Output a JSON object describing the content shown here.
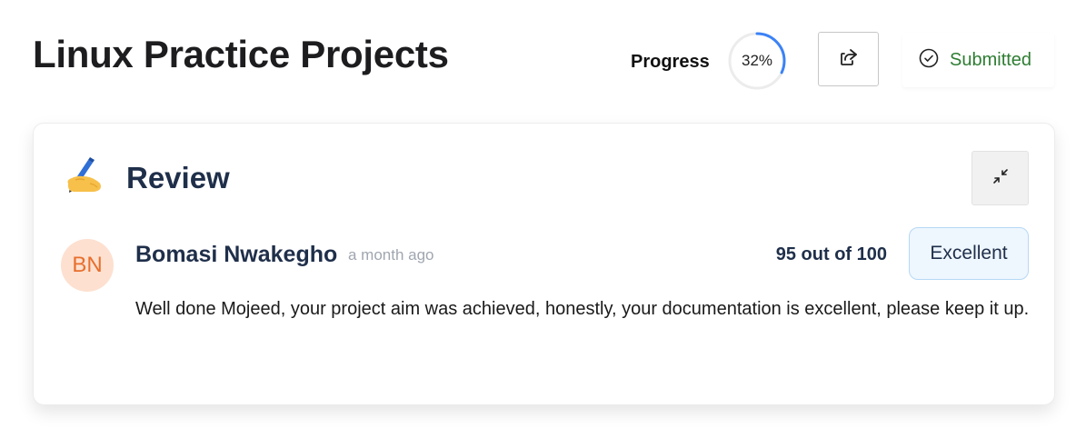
{
  "header": {
    "title": "Linux Practice Projects",
    "progress_label": "Progress",
    "progress_value": "32%",
    "progress_fraction": 0.32,
    "share_icon": "share-icon",
    "status_icon": "check-circle-icon",
    "status_text": "Submitted"
  },
  "review": {
    "heading": "Review",
    "heading_icon": "writing-hand-icon",
    "collapse_icon": "collapse-icon",
    "reviewer": {
      "initials": "BN",
      "name": "Bomasi Nwakegho",
      "time": "a month ago"
    },
    "score": "95 out of 100",
    "rating": "Excellent",
    "comment": "Well done Mojeed, your project aim was achieved, honestly, your documentation is excellent, please keep it up."
  },
  "colors": {
    "progress_ring": "#3b82f6",
    "progress_track": "#ececec",
    "status_text": "#2e7d32",
    "avatar_bg": "#fde0d0",
    "avatar_text": "#e76f2d",
    "rating_bg": "#eef6fe",
    "rating_border": "#b6d8f5",
    "heading": "#1f2f4a"
  }
}
